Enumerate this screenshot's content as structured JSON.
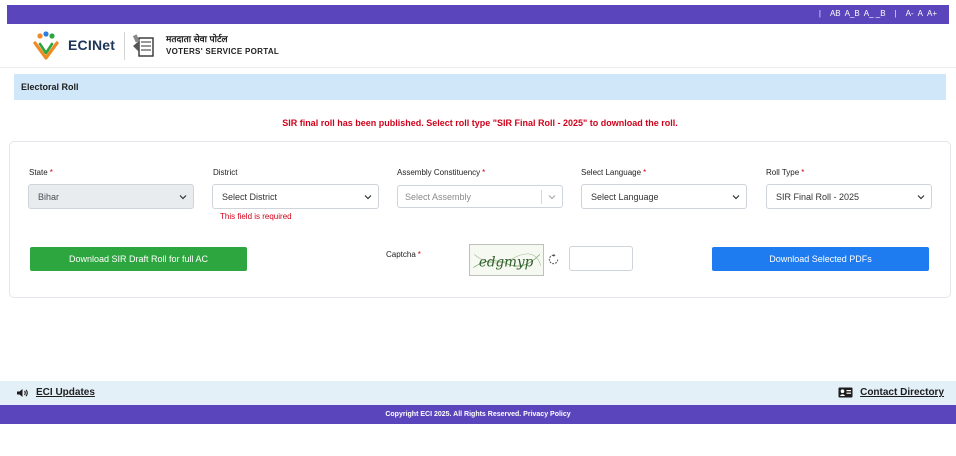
{
  "topbar": {
    "links": [
      "AB",
      "A_B",
      "A_ _B"
    ],
    "font_sizes": [
      "A-",
      "A",
      "A+"
    ]
  },
  "header": {
    "logo_text": "ECINet",
    "portal_hindi": "मतदाता सेवा पोर्टल",
    "portal_name": "VOTERS' SERVICE PORTAL"
  },
  "breadcrumb": {
    "title": "Electoral Roll"
  },
  "alert": {
    "message": "SIR final roll has been published. Select roll type \"SIR Final Roll - 2025\" to download the roll."
  },
  "form": {
    "state": {
      "label": "State",
      "value": "Bihar"
    },
    "district": {
      "label": "District",
      "value": "Select District",
      "error": "This field is required"
    },
    "assembly": {
      "label": "Assembly Constituency",
      "placeholder": "Select Assembly"
    },
    "language": {
      "label": "Select Language",
      "value": "Select Language"
    },
    "roll_type": {
      "label": "Roll Type",
      "value": "SIR Final Roll - 2025"
    },
    "required_mark": "*",
    "captcha_label": "Captcha",
    "captcha_text": "edgmyp",
    "download_draft_label": "Download SIR Draft Roll for full AC",
    "download_selected_label": "Download Selected PDFs"
  },
  "footer": {
    "eci_updates": "ECI Updates",
    "contact_directory": "Contact Directory",
    "copyright": "Copyright ECI 2025. All Rights Reserved. Privacy Policy"
  },
  "colors": {
    "brand_purple": "#5a45bd",
    "alert_red": "#d0021b",
    "button_green": "#2ea63f",
    "button_blue": "#1f7bf0",
    "breadcrumb_bg": "#cfe7f8"
  }
}
